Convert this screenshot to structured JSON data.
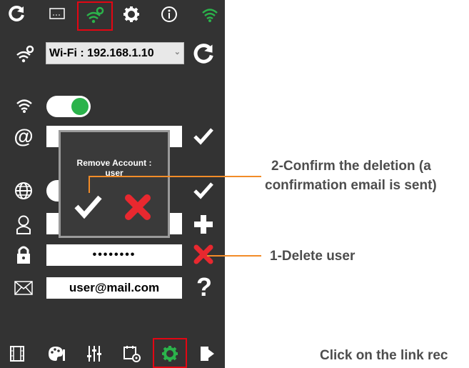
{
  "topbar": {
    "icons": [
      "refresh-icon",
      "ticket-icon",
      "wifi-settings-icon",
      "gear-icon",
      "info-icon",
      "wifi-signal-icon"
    ]
  },
  "network": {
    "selected": "Wi-Fi : 192.168.1.10"
  },
  "form": {
    "wifi_enabled": true,
    "password_mask": "••••••••",
    "email_value": "user@mail.com"
  },
  "dialog": {
    "title_line1": "Remove Account :",
    "title_line2": "user"
  },
  "annotations": {
    "confirm_line1": "2-Confirm the deletion (a",
    "confirm_line2": "confirmation email is sent)",
    "delete": "1-Delete user",
    "footer": "Click on the link rec"
  },
  "bottombar": {
    "icons": [
      "film-icon",
      "palette-icon",
      "sliders-icon",
      "calendar-icon",
      "gear-icon",
      "exit-icon"
    ]
  },
  "colors": {
    "panel": "#333333",
    "accent_green": "#2bb34b",
    "highlight_red": "#e30613",
    "annotation_orange": "#f28c28",
    "delete_red": "#e8282f"
  }
}
